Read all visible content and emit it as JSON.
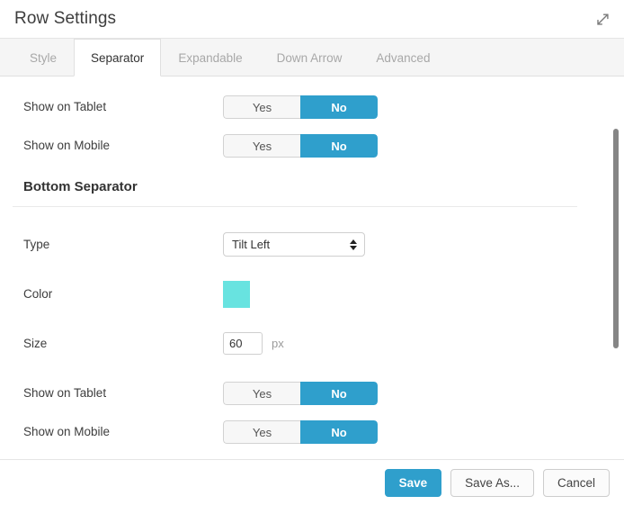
{
  "header": {
    "title": "Row Settings",
    "expand_icon": "expand-arrows-icon"
  },
  "tabs": [
    {
      "label": "Style",
      "active": false
    },
    {
      "label": "Separator",
      "active": true
    },
    {
      "label": "Expandable",
      "active": false
    },
    {
      "label": "Down Arrow",
      "active": false
    },
    {
      "label": "Advanced",
      "active": false
    }
  ],
  "form": {
    "top_rows": [
      {
        "label": "Show on Tablet",
        "yes_label": "Yes",
        "no_label": "No",
        "selected": "No"
      },
      {
        "label": "Show on Mobile",
        "yes_label": "Yes",
        "no_label": "No",
        "selected": "No"
      }
    ],
    "section_title": "Bottom Separator",
    "type_row": {
      "label": "Type",
      "value": "Tilt Left"
    },
    "color_row": {
      "label": "Color",
      "value": "#68e3e0"
    },
    "size_row": {
      "label": "Size",
      "value": "60",
      "unit": "px"
    },
    "bottom_rows": [
      {
        "label": "Show on Tablet",
        "yes_label": "Yes",
        "no_label": "No",
        "selected": "No"
      },
      {
        "label": "Show on Mobile",
        "yes_label": "Yes",
        "no_label": "No",
        "selected": "No"
      }
    ]
  },
  "footer": {
    "save": "Save",
    "save_as": "Save As...",
    "cancel": "Cancel"
  },
  "colors": {
    "accent": "#2f9fcc",
    "swatch": "#68e3e0"
  }
}
